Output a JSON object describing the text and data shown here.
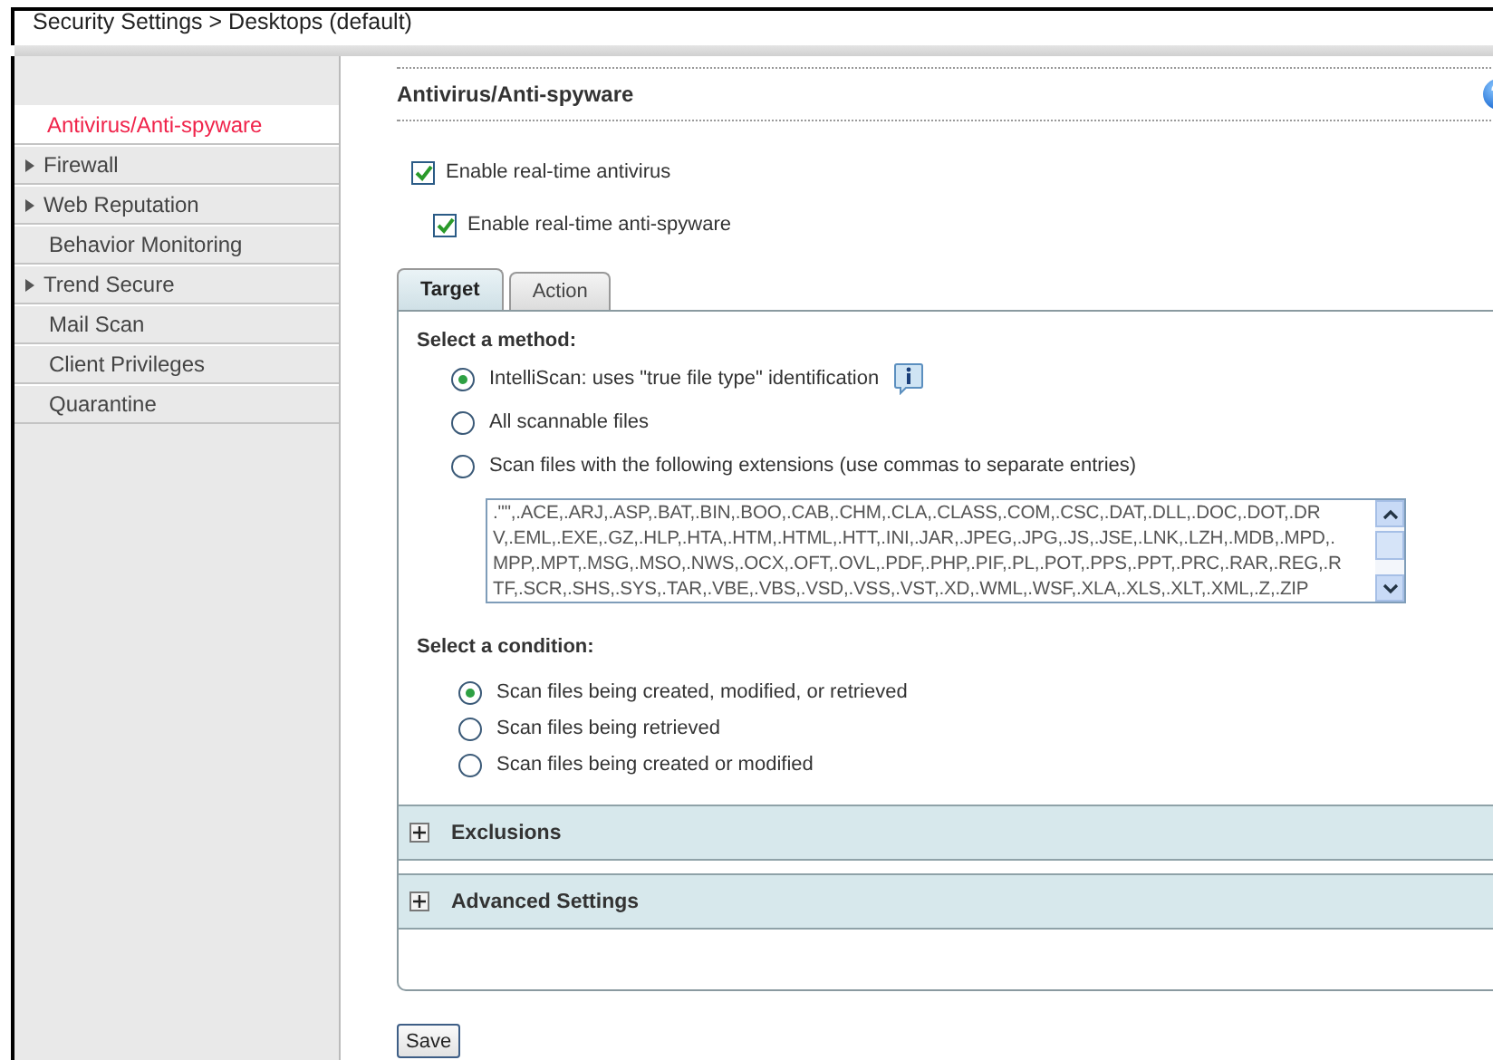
{
  "breadcrumb": "Security Settings > Desktops (default)",
  "sidebar": {
    "items": [
      {
        "label": "Antivirus/Anti-spyware",
        "selected": true,
        "expandable": false
      },
      {
        "label": "Firewall",
        "selected": false,
        "expandable": true
      },
      {
        "label": "Web Reputation",
        "selected": false,
        "expandable": true
      },
      {
        "label": "Behavior Monitoring",
        "selected": false,
        "expandable": false
      },
      {
        "label": "Trend Secure",
        "selected": false,
        "expandable": true
      },
      {
        "label": "Mail Scan",
        "selected": false,
        "expandable": false
      },
      {
        "label": "Client Privileges",
        "selected": false,
        "expandable": false
      },
      {
        "label": "Quarantine",
        "selected": false,
        "expandable": false
      }
    ]
  },
  "page_title": "Antivirus/Anti-spyware",
  "options": [
    {
      "label": "Enable real-time antivirus",
      "checked": true
    },
    {
      "label": "Enable real-time anti-spyware",
      "checked": true
    }
  ],
  "tabs": [
    {
      "label": "Target",
      "selected": true
    },
    {
      "label": "Action",
      "selected": false
    }
  ],
  "method": {
    "heading": "Select a method:",
    "choices": [
      {
        "label": "IntelliScan: uses \"true file type\" identification",
        "selected": true,
        "info": true
      },
      {
        "label": "All scannable files",
        "selected": false
      },
      {
        "label": "Scan files with the following extensions (use commas to separate entries)",
        "selected": false
      }
    ],
    "extensions_lines": [
      ".\"\",.ACE,.ARJ,.ASP,.BAT,.BIN,.BOO,.CAB,.CHM,.CLA,.CLASS,.COM,.CSC,.DAT,.DLL,.DOC,.DOT,.DR",
      "V,.EML,.EXE,.GZ,.HLP,.HTA,.HTM,.HTML,.HTT,.INI,.JAR,.JPEG,.JPG,.JS,.JSE,.LNK,.LZH,.MDB,.MPD,.",
      "MPP,.MPT,.MSG,.MSO,.NWS,.OCX,.OFT,.OVL,.PDF,.PHP,.PIF,.PL,.POT,.PPS,.PPT,.PRC,.RAR,.REG,.R",
      "TF,.SCR,.SHS,.SYS,.TAR,.VBE,.VBS,.VSD,.VSS,.VST,.XD,.WML,.WSF,.XLA,.XLS,.XLT,.XML,.Z,.ZIP"
    ]
  },
  "condition": {
    "heading": "Select a condition:",
    "choices": [
      {
        "label": "Scan files being created, modified, or retrieved",
        "selected": true
      },
      {
        "label": "Scan files being retrieved",
        "selected": false
      },
      {
        "label": "Scan files being created or modified",
        "selected": false
      }
    ]
  },
  "sections": [
    {
      "label": "Exclusions",
      "expanded": false
    },
    {
      "label": "Advanced Settings",
      "expanded": false
    }
  ],
  "save_button": "Save"
}
